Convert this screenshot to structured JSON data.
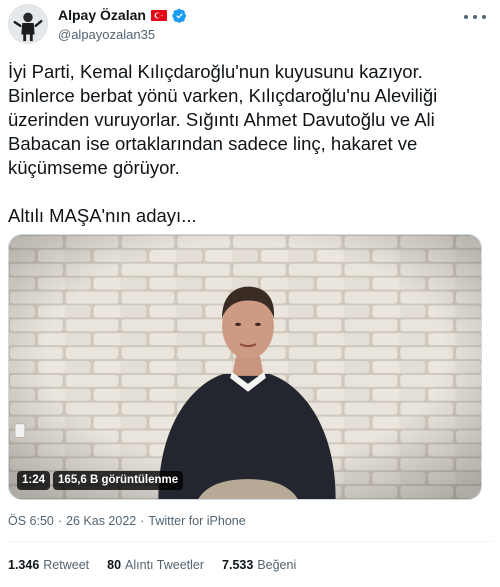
{
  "author": {
    "display_name": "Alpay Özalan",
    "handle": "@alpayozalan35",
    "avatar_icon": "avatar-photo",
    "flag_icon": "turkey-flag-icon",
    "verified_icon": "verified-badge-icon"
  },
  "tweet": {
    "text_paragraphs": [
      "İyi Parti, Kemal Kılıçdaroğlu'nun kuyusunu kazıyor. Binlerce berbat yönü varken, Kılıçdaroğlu'nu Aleviliği üzerinden vuruyorlar. Sığıntı Ahmet Davutoğlu ve Ali Babacan ise ortaklarından sadece linç, hakaret ve küçümseme görüyor.",
      "Altılı MAŞA'nın adayı..."
    ]
  },
  "media": {
    "duration": "1:24",
    "views": "165,6 B görüntülenme"
  },
  "meta": {
    "time": "ÖS 6:50",
    "separator": "·",
    "date": "26 Kas 2022",
    "source": "Twitter for iPhone"
  },
  "stats": {
    "retweets": {
      "count": "1.346",
      "label": "Retweet"
    },
    "quotes": {
      "count": "80",
      "label": "Alıntı Tweetler"
    },
    "likes": {
      "count": "7.533",
      "label": "Beğeni"
    }
  },
  "colors": {
    "text": "#0f1419",
    "secondary": "#536471",
    "verified": "#1d9bf0",
    "flag": "#e30a17"
  }
}
